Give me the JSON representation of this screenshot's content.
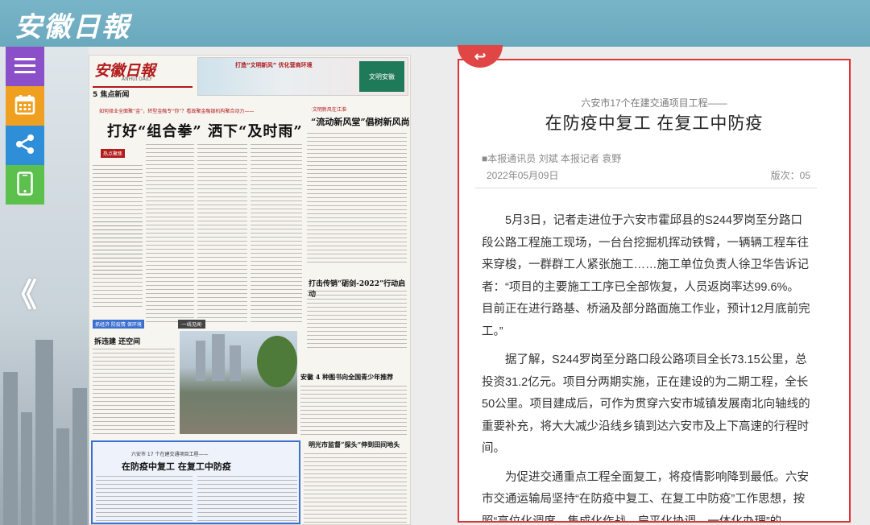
{
  "header": {
    "logo_text": "安徽日報"
  },
  "side_tools": [
    {
      "name": "menu-icon"
    },
    {
      "name": "calendar-icon"
    },
    {
      "name": "share-icon"
    },
    {
      "name": "mobile-icon"
    }
  ],
  "nav": {
    "prev_arrow": "《"
  },
  "newspaper": {
    "masthead": "安徽日報",
    "masthead_en": "ANHUI DAILY",
    "section": "5 焦点新闻",
    "banner_text": "打造“文明新风”  优化营商环境",
    "banner_badge": "文明安徽",
    "kicker": "如何择业全面聚“金”，转型金融专“你”？看政聚金融银机构聚合动力——",
    "headline": "打好“组合拳” 洒下“及时雨”",
    "side_kicker": "·文明新风在江淮·",
    "side_headline": "“流动新风堂”倡树新风尚",
    "mid_head_1": "打击传销“砺剑-2022”行动启动",
    "mid_head_2": "安徽 4 种图书向全国青少年推荐",
    "mid_head_3": "明光市监督“探头”伸到田间地头",
    "photo_caption": "拆违建 还空间",
    "label_1": "热点聚焦",
    "label_2": "抓经济 防疫情 保环境",
    "label_3": "·一线见闻·",
    "highlight_kicker": "六安市 17 个在建交通项目工程——",
    "highlight_headline": "在防疫中复工 在复工中防疫"
  },
  "article": {
    "back_icon": "↩",
    "kicker": "六安市17个在建交通项目工程——",
    "title": "在防疫中复工 在复工中防疫",
    "byline": "■本报通讯员 刘斌 本报记者 袁野",
    "date": "2022年05月09日",
    "page": "版次：05",
    "paragraphs": [
      "5月3日，记者走进位于六安市霍邱县的S244罗岗至分路口段公路工程施工现场，一台台挖掘机挥动铁臂，一辆辆工程车往来穿梭，一群群工人紧张施工……施工单位负责人徐卫华告诉记者：“项目的主要施工工序已全部恢复，人员返岗率达99.6%。目前正在进行路基、桥涵及部分路面施工作业，预计12月底前完工。”",
      "据了解，S244罗岗至分路口段公路项目全长73.15公里，总投资31.2亿元。项目分两期实施，正在建设的为二期工程，全长50公里。项目建成后，可作为贯穿六安市城镇发展南北向轴线的重要补充，将大大减少沿线乡镇到达六安市及上下高速的行程时间。",
      "为促进交通重点工程全面复工，将疫情影响降到最低。六安市交通运输局坚持“在防疫中复工、在复工中防疫”工作思想，按照“高位化调度、集成化作战、扁平化协调、一体化办理”的"
    ]
  },
  "colors": {
    "topbar": "#6aa8bd",
    "menu": "#8b4fc9",
    "calendar": "#f0a020",
    "share": "#2f8ed8",
    "mobile": "#5cc04c",
    "article_border": "#e03434",
    "newspaper_red": "#b11b1b"
  }
}
